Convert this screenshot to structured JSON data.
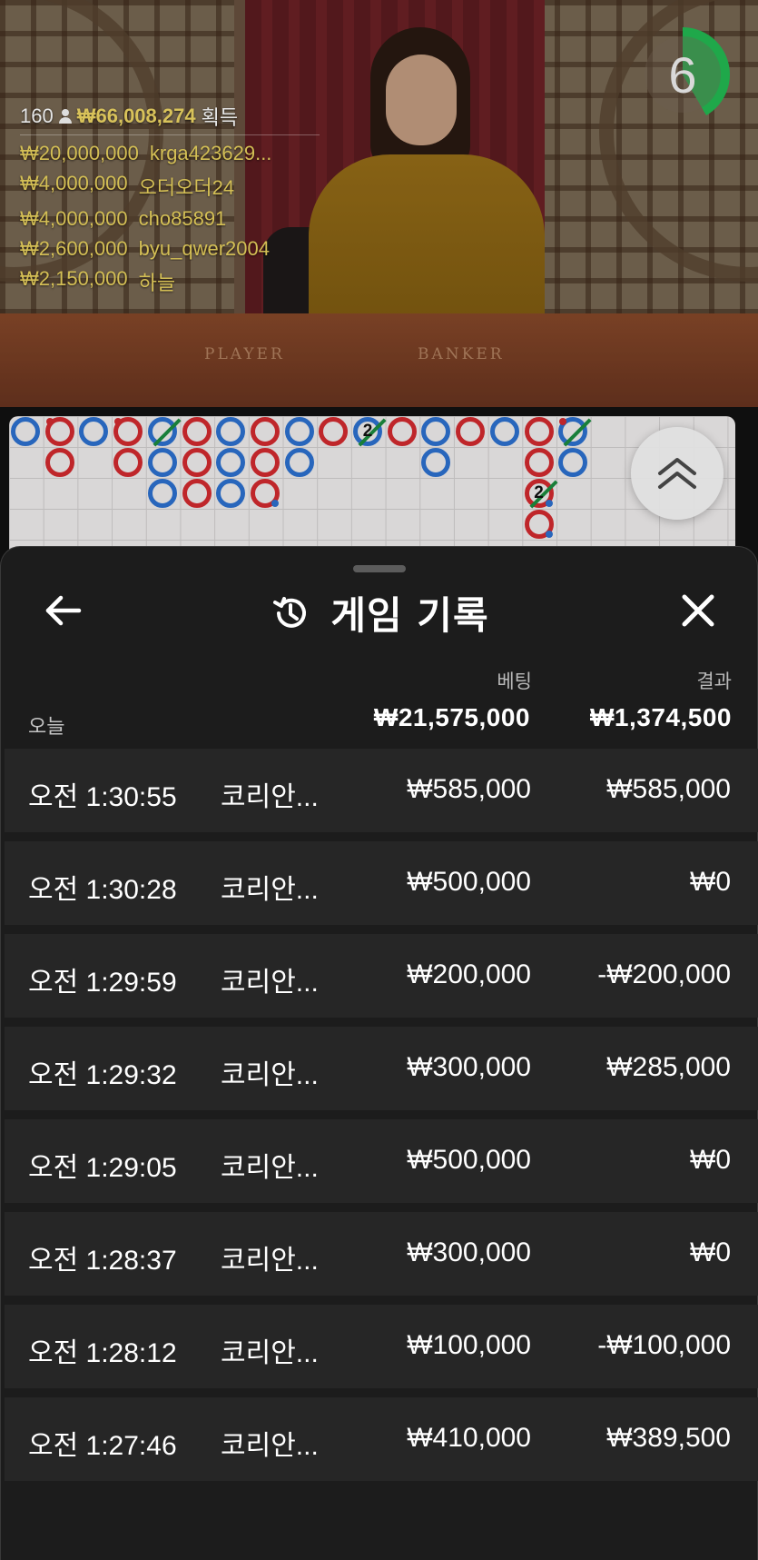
{
  "video": {
    "timer": "6",
    "felt_player": "PLAYER",
    "felt_banker": "BANKER",
    "winners": {
      "count": "160",
      "total": "₩66,008,274",
      "suffix": "획득",
      "list": [
        {
          "amount": "₩20,000,000",
          "name": "krga423629..."
        },
        {
          "amount": "₩4,000,000",
          "name": "오더오더24"
        },
        {
          "amount": "₩4,000,000",
          "name": "cho85891"
        },
        {
          "amount": "₩2,600,000",
          "name": "byu_qwer2004"
        },
        {
          "amount": "₩2,150,000",
          "name": "하늘"
        }
      ]
    }
  },
  "road": {
    "colors": {
      "player": "#2c6fcc",
      "banker": "#d02a2e",
      "tie": "#1c8a3e"
    },
    "columns": [
      [
        "P"
      ],
      [
        "B+bp",
        "B"
      ],
      [
        "P"
      ],
      [
        "B+bp",
        "B"
      ],
      [
        "P+tie",
        "P",
        "P"
      ],
      [
        "B",
        "B",
        "B"
      ],
      [
        "P",
        "P",
        "P"
      ],
      [
        "B",
        "B",
        "B+pp"
      ],
      [
        "P",
        "P"
      ],
      [
        "B"
      ],
      [
        "P+tie2"
      ],
      [
        "B"
      ],
      [
        "P",
        "P"
      ],
      [
        "B"
      ],
      [
        "P"
      ],
      [
        "B",
        "B",
        "B+pp+tie2",
        "B+pp"
      ],
      [
        "P+bp+tie",
        "P"
      ]
    ]
  },
  "sheet": {
    "title": "게임 기록",
    "col_bet": "베팅",
    "col_result": "결과",
    "today_label": "오늘",
    "total_bet": "₩21,575,000",
    "total_result": "₩1,374,500",
    "rows": [
      {
        "time": "오전 1:30:55",
        "game": "코리안...",
        "bet": "₩585,000",
        "result": "₩585,000"
      },
      {
        "time": "오전 1:30:28",
        "game": "코리안...",
        "bet": "₩500,000",
        "result": "₩0"
      },
      {
        "time": "오전 1:29:59",
        "game": "코리안...",
        "bet": "₩200,000",
        "result": "-₩200,000"
      },
      {
        "time": "오전 1:29:32",
        "game": "코리안...",
        "bet": "₩300,000",
        "result": "₩285,000"
      },
      {
        "time": "오전 1:29:05",
        "game": "코리안...",
        "bet": "₩500,000",
        "result": "₩0"
      },
      {
        "time": "오전 1:28:37",
        "game": "코리안...",
        "bet": "₩300,000",
        "result": "₩0"
      },
      {
        "time": "오전 1:28:12",
        "game": "코리안...",
        "bet": "₩100,000",
        "result": "-₩100,000"
      },
      {
        "time": "오전 1:27:46",
        "game": "코리안...",
        "bet": "₩410,000",
        "result": "₩389,500"
      }
    ]
  }
}
